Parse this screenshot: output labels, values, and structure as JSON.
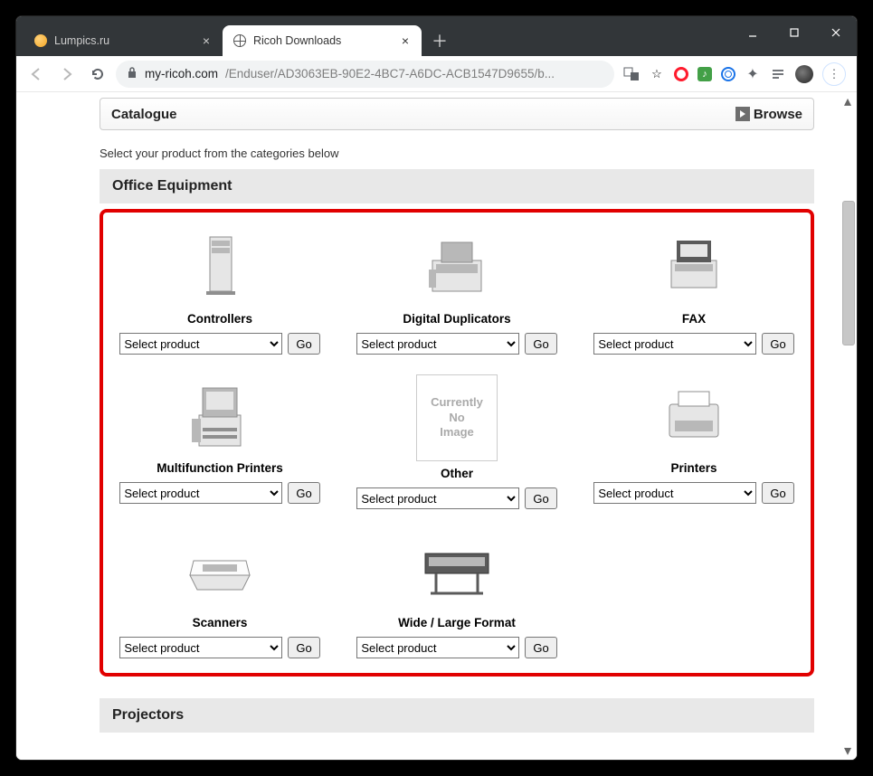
{
  "window": {
    "tabs": [
      {
        "title": "Lumpics.ru",
        "active": false
      },
      {
        "title": "Ricoh Downloads",
        "active": true
      }
    ]
  },
  "address": {
    "host": "my-ricoh.com",
    "path": "/Enduser/AD3063EB-90E2-4BC7-A6DC-ACB1547D9655/b..."
  },
  "catalogue": {
    "title": "Catalogue",
    "browse_label": "Browse"
  },
  "instruction": "Select your product from the categories below",
  "section1_title": "Office Equipment",
  "categories": [
    {
      "name": "Controllers",
      "placeholder": "Select product",
      "go": "Go",
      "img": "tower"
    },
    {
      "name": "Digital Duplicators",
      "placeholder": "Select product",
      "go": "Go",
      "img": "duplicator"
    },
    {
      "name": "FAX",
      "placeholder": "Select product",
      "go": "Go",
      "img": "fax"
    },
    {
      "name": "Multifunction Printers",
      "placeholder": "Select product",
      "go": "Go",
      "img": "mfp"
    },
    {
      "name": "Other",
      "placeholder": "Select product",
      "go": "Go",
      "img": "noimage",
      "noimage_text": [
        "Currently",
        "No",
        "Image"
      ]
    },
    {
      "name": "Printers",
      "placeholder": "Select product",
      "go": "Go",
      "img": "printer"
    },
    {
      "name": "Scanners",
      "placeholder": "Select product",
      "go": "Go",
      "img": "scanner"
    },
    {
      "name": "Wide / Large Format",
      "placeholder": "Select product",
      "go": "Go",
      "img": "wide"
    }
  ],
  "section2_title": "Projectors"
}
